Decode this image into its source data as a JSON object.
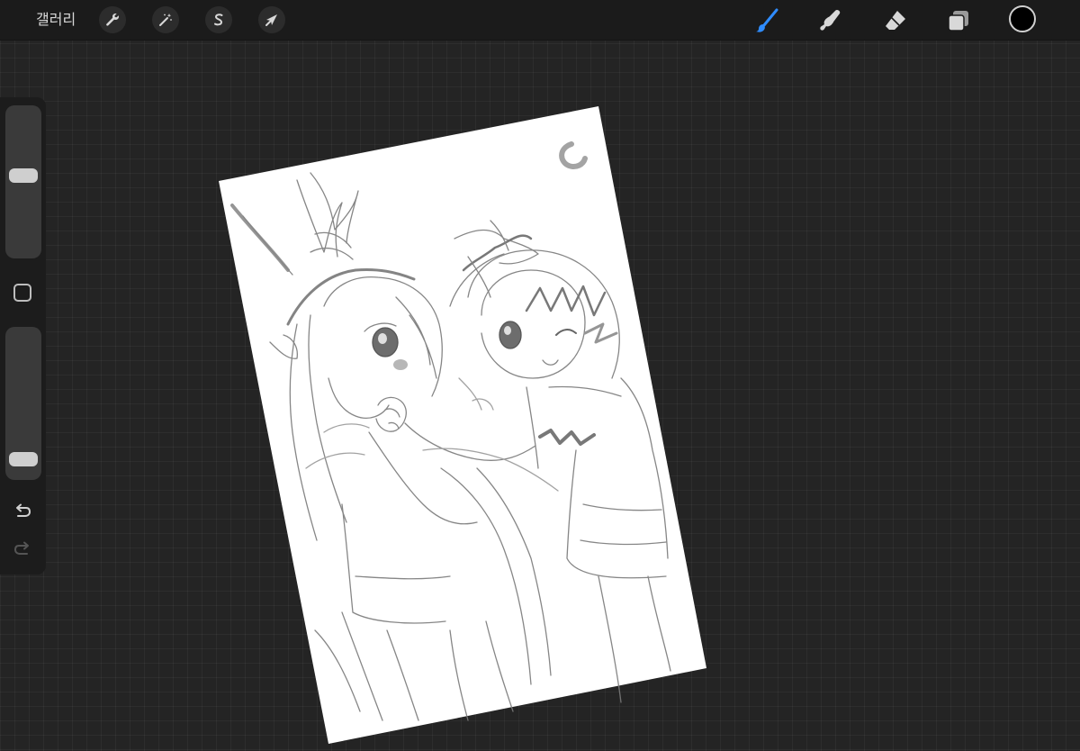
{
  "topbar": {
    "gallery_label": "갤러리",
    "left_tools": [
      {
        "name": "actions",
        "icon": "wrench-icon"
      },
      {
        "name": "adjustments",
        "icon": "magic-wand-icon"
      },
      {
        "name": "selection",
        "icon": "selection-s-icon"
      },
      {
        "name": "transform",
        "icon": "arrow-cursor-icon"
      }
    ],
    "right_tools": [
      {
        "name": "brush",
        "icon": "brush-icon",
        "active": true
      },
      {
        "name": "smudge",
        "icon": "smudge-finger-icon",
        "active": false
      },
      {
        "name": "eraser",
        "icon": "eraser-icon",
        "active": false
      },
      {
        "name": "layers",
        "icon": "layers-icon",
        "active": false
      }
    ],
    "current_color": "#000000"
  },
  "sidebar": {
    "brush_size_level": 0.55,
    "opacity_level": 0.05,
    "icons": [
      "modify-square-icon",
      "undo-icon",
      "redo-icon"
    ]
  },
  "colors": {
    "accent": "#2f8cff",
    "workspace_bg": "#242424",
    "topbar_bg": "#1b1b1b",
    "icon": "#d8d8d8",
    "paper": "#ffffff"
  }
}
